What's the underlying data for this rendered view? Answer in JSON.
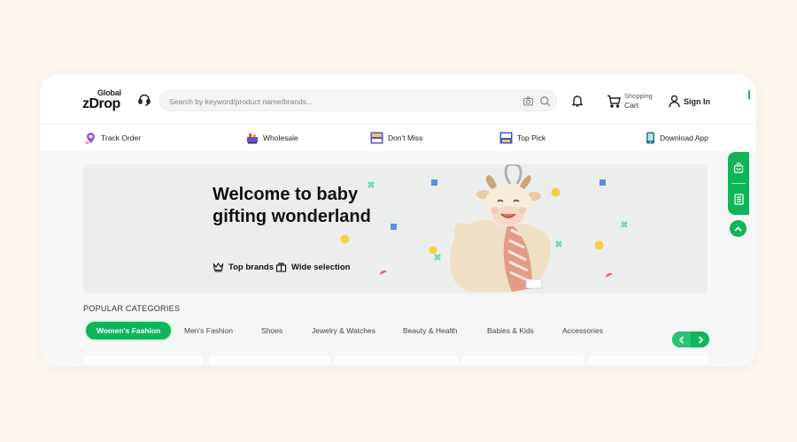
{
  "brand": {
    "top": "Global",
    "main": "zDrop"
  },
  "search": {
    "placeholder": "Search by keyword/product name/brands..."
  },
  "header": {
    "cart_line1": "Shopping",
    "cart_line2": "Cart",
    "sign_in": "Sign In"
  },
  "nav": {
    "items": [
      {
        "label": "Track Order",
        "icon": "location-pin-icon"
      },
      {
        "label": "Wholesale",
        "icon": "wholesale-icon"
      },
      {
        "label": "Don't Miss",
        "icon": "best-price-icon"
      },
      {
        "label": "Top Pick",
        "icon": "top-pick-icon"
      },
      {
        "label": "Download App",
        "icon": "phone-icon"
      }
    ]
  },
  "banner": {
    "headline": "Welcome to baby gifting wonderland",
    "features": [
      {
        "label": "Top brands",
        "icon": "crown-icon"
      },
      {
        "label": "Wide selection",
        "icon": "gift-box-icon"
      }
    ]
  },
  "categories": {
    "title": "POPULAR CATEGORIES",
    "tabs": [
      {
        "label": "Women's Fashion",
        "active": true
      },
      {
        "label": "Men's Fashion",
        "active": false
      },
      {
        "label": "Shoes",
        "active": false
      },
      {
        "label": "Jewelry & Watches",
        "active": false
      },
      {
        "label": "Beauty & Health",
        "active": false
      },
      {
        "label": "Babies & Kids",
        "active": false
      },
      {
        "label": "Accessories",
        "active": false
      }
    ]
  },
  "floating": {
    "icons": [
      "shopping-bag-icon",
      "document-list-icon",
      "arrow-up-icon"
    ]
  },
  "colors": {
    "accent": "#0fb45b",
    "background": "#fdf7f0",
    "banner": "#eceeee"
  }
}
